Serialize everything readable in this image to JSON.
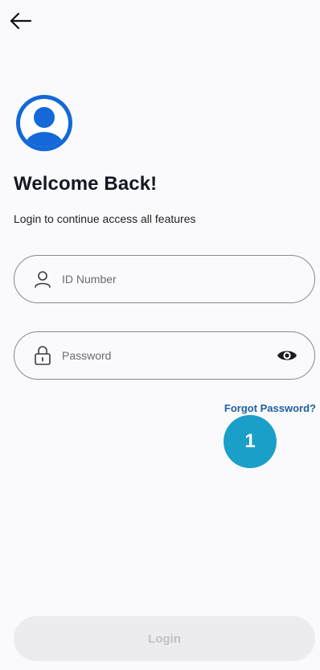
{
  "header": {
    "back_icon": "arrow-left-icon"
  },
  "welcome": {
    "avatar_icon": "user-avatar-icon",
    "title": "Welcome Back!",
    "subtitle": "Login to continue access all features"
  },
  "form": {
    "id_field": {
      "icon": "user-icon",
      "placeholder": "ID Number",
      "value": ""
    },
    "password_field": {
      "icon": "lock-icon",
      "placeholder": "Password",
      "value": "",
      "toggle_icon": "eye-icon"
    },
    "forgot_label": "Forgot Password?"
  },
  "annotation": {
    "step_number": "1"
  },
  "footer": {
    "login_label": "Login",
    "login_enabled": false
  },
  "colors": {
    "accent": "#1468d8",
    "link": "#1e5fa0",
    "badge": "#1aa0c8",
    "disabled_button_bg": "#ececef",
    "disabled_button_text": "#c2c2c6"
  }
}
